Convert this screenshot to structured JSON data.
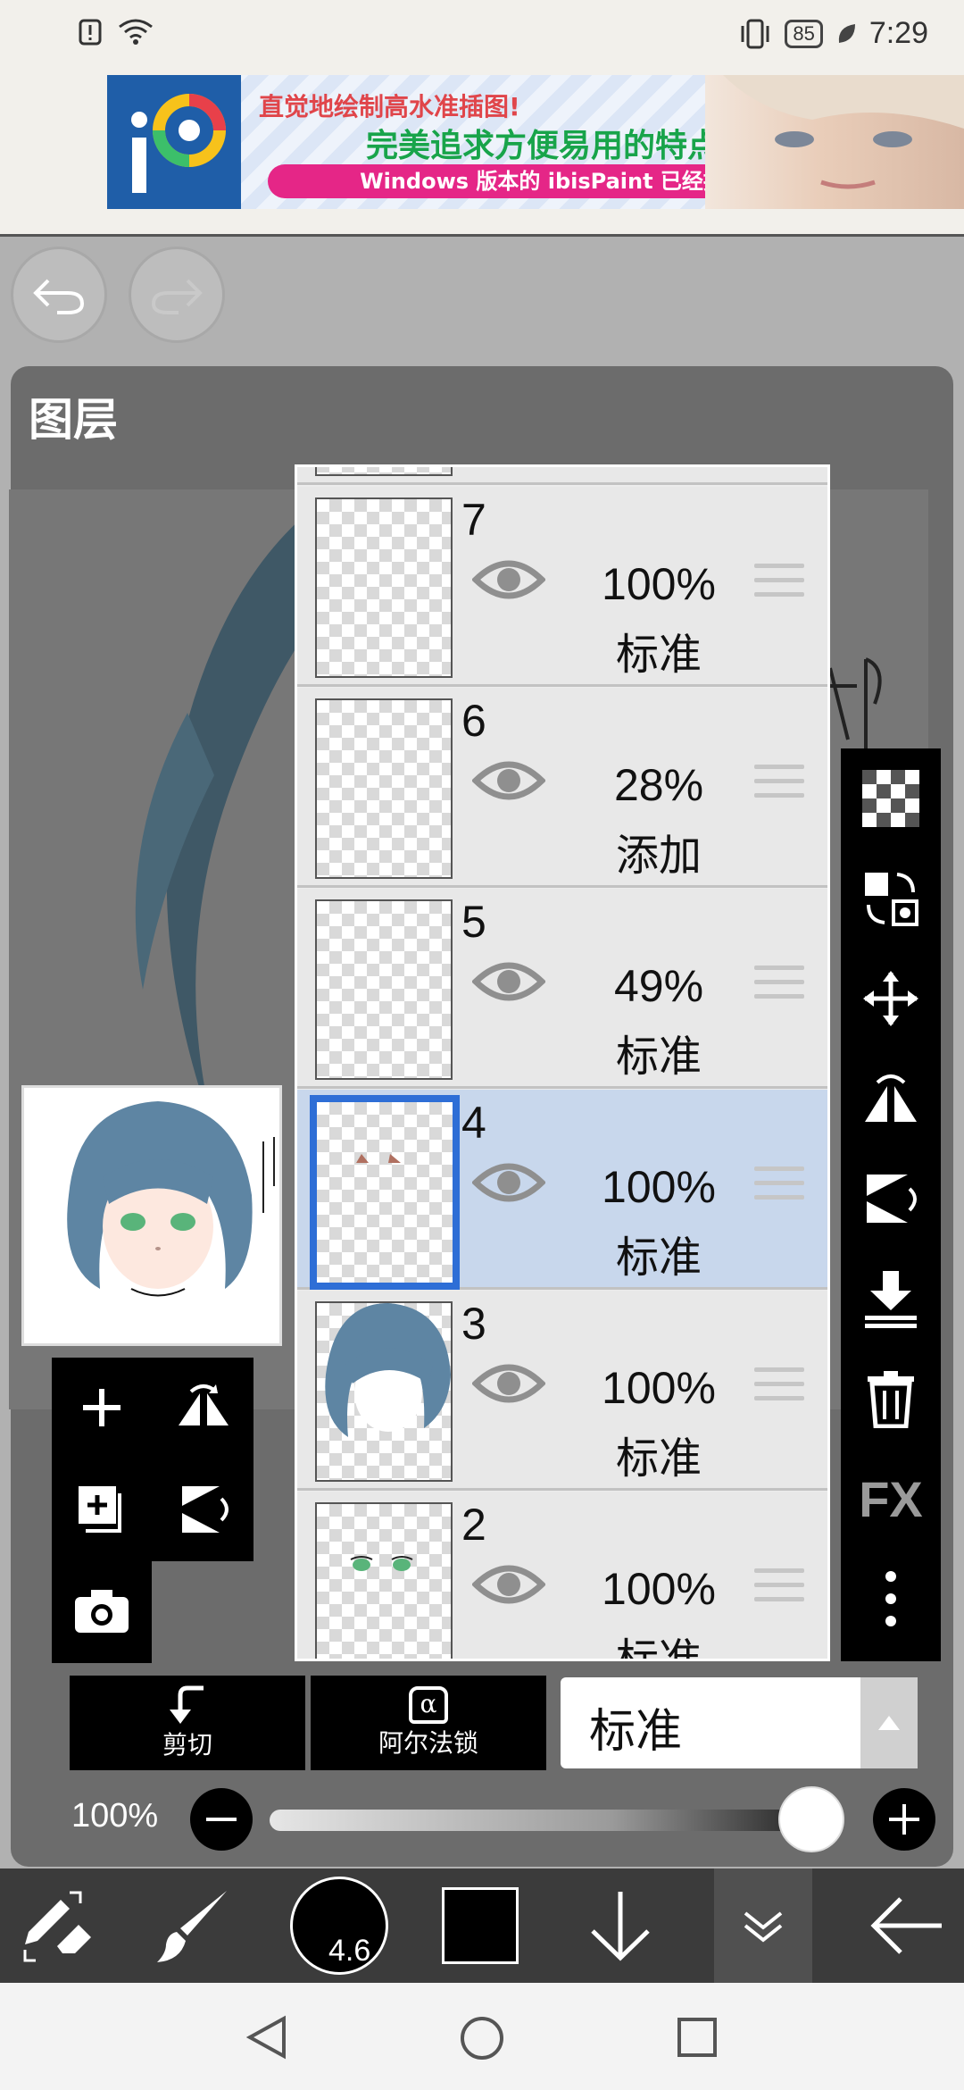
{
  "status_bar": {
    "battery": "85",
    "time": "7:29",
    "icons": [
      "alert-icon",
      "wifi-icon",
      "vibrate-icon",
      "leaf-icon"
    ]
  },
  "ad": {
    "logo_text": "iP",
    "line1": "直觉地绘制高水准插图!",
    "line2": "完美追求方便易用的特点!",
    "pill": "Windows 版本的 ibisPaint 已经推出!"
  },
  "panel": {
    "title": "图层"
  },
  "layers": [
    {
      "number": "7",
      "opacity": "100%",
      "blend": "标准"
    },
    {
      "number": "6",
      "opacity": "28%",
      "blend": "添加"
    },
    {
      "number": "5",
      "opacity": "49%",
      "blend": "标准"
    },
    {
      "number": "4",
      "opacity": "100%",
      "blend": "标准",
      "selected": true
    },
    {
      "number": "3",
      "opacity": "100%",
      "blend": "标准"
    },
    {
      "number": "2",
      "opacity": "100%",
      "blend": "标准"
    }
  ],
  "right_toolbar": {
    "fx_label": "FX"
  },
  "controls": {
    "clip_label": "剪切",
    "alpha_lock_label": "阿尔法锁",
    "alpha_symbol": "α",
    "blend_mode": "标准",
    "opacity_label": "100%",
    "opacity_value": 1.0
  },
  "bottom_toolbar": {
    "brush_size": "4.6"
  },
  "colors": {
    "accent": "#2e6ed6",
    "selected_row": "#c8d7ec",
    "panel_bg": "#6c6c6c"
  }
}
